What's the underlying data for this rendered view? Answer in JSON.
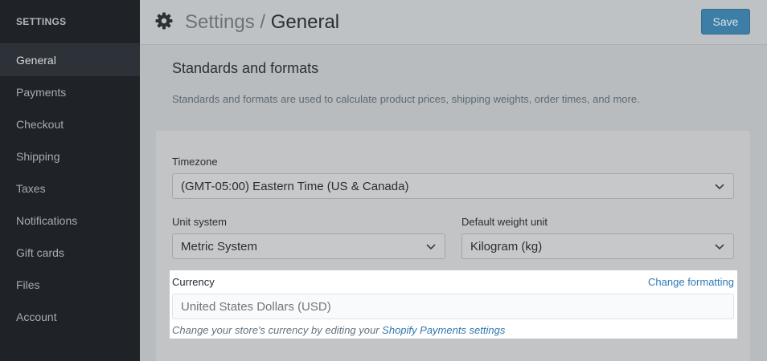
{
  "sidebar": {
    "heading": "SETTINGS",
    "items": [
      {
        "label": "General",
        "active": true
      },
      {
        "label": "Payments"
      },
      {
        "label": "Checkout"
      },
      {
        "label": "Shipping"
      },
      {
        "label": "Taxes"
      },
      {
        "label": "Notifications"
      },
      {
        "label": "Gift cards"
      },
      {
        "label": "Files"
      },
      {
        "label": "Account"
      }
    ]
  },
  "header": {
    "parent": "Settings",
    "separator": " / ",
    "current": "General",
    "save_label": "Save"
  },
  "section": {
    "title": "Standards and formats",
    "description": "Standards and formats are used to calculate product prices, shipping weights, order times, and more."
  },
  "form": {
    "timezone": {
      "label": "Timezone",
      "value": "(GMT-05:00) Eastern Time (US & Canada)"
    },
    "unit_system": {
      "label": "Unit system",
      "value": "Metric System"
    },
    "weight_unit": {
      "label": "Default weight unit",
      "value": "Kilogram (kg)"
    },
    "currency": {
      "label": "Currency",
      "change_link": "Change formatting",
      "placeholder": "United States Dollars (USD)",
      "help_prefix": "Change your store's currency by editing your ",
      "help_link": "Shopify Payments settings"
    }
  },
  "colors": {
    "sidebar_bg": "#1f2327",
    "accent": "#2f79b3",
    "save_button": "#3d7ea6"
  },
  "icons": [
    "gear-icon",
    "chevron-down-icon"
  ]
}
